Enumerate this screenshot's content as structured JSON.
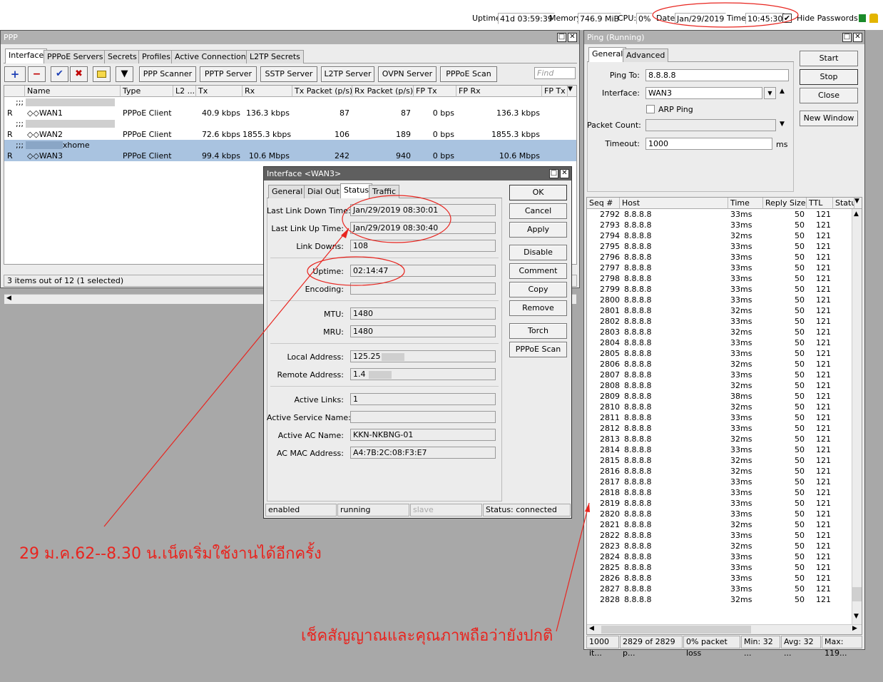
{
  "topbar": {
    "uptime_label": "Uptime:",
    "uptime": "41d 03:59:39",
    "memory_label": "Memory:",
    "memory": "746.9 MiB",
    "cpu_label": "CPU:",
    "cpu": "0%",
    "date_label": "Date:",
    "date": "Jan/29/2019",
    "time_label": "Time:",
    "time": "10:45:30",
    "hide_passwords": "Hide Passwords"
  },
  "ppp": {
    "title": "PPP",
    "tabs": [
      "Interface",
      "PPPoE Servers",
      "Secrets",
      "Profiles",
      "Active Connections",
      "L2TP Secrets"
    ],
    "toolbar": [
      "PPP Scanner",
      "PPTP Server",
      "SSTP Server",
      "L2TP Server",
      "OVPN Server",
      "PPPoE Scan"
    ],
    "find_placeholder": "Find",
    "columns": [
      "Name",
      "Type",
      "L2 ...",
      "Tx",
      "Rx",
      "Tx Packet (p/s)",
      "Rx Packet (p/s)",
      "FP Tx",
      "FP Rx",
      "FP Tx"
    ],
    "rows": [
      {
        "comment": ";;;",
        "flag": "R",
        "name": "WAN1",
        "type": "PPPoE Client",
        "tx": "40.9 kbps",
        "rx": "136.3 kbps",
        "txp": "87",
        "rxp": "87",
        "fptx": "0 bps",
        "fprx": "136.3 kbps"
      },
      {
        "comment": ";;;",
        "flag": "R",
        "name": "WAN2",
        "type": "PPPoE Client",
        "tx": "72.6 kbps",
        "rx": "1855.3 kbps",
        "txp": "106",
        "rxp": "189",
        "fptx": "0 bps",
        "fprx": "1855.3 kbps"
      },
      {
        "comment": ";;; 5871@fttxhome",
        "flag": "R",
        "name": "WAN3",
        "type": "PPPoE Client",
        "tx": "99.4 kbps",
        "rx": "10.6 Mbps",
        "txp": "242",
        "rxp": "940",
        "fptx": "0 bps",
        "fprx": "10.6 Mbps"
      }
    ],
    "status": "3 items out of 12 (1 selected)"
  },
  "iface": {
    "title": "Interface <WAN3>",
    "tabs": [
      "General",
      "Dial Out",
      "Status",
      "Traffic"
    ],
    "buttons": [
      "OK",
      "Cancel",
      "Apply",
      "Disable",
      "Comment",
      "Copy",
      "Remove",
      "Torch",
      "PPPoE Scan"
    ],
    "fields": {
      "last_link_down_label": "Last Link Down Time:",
      "last_link_down": "Jan/29/2019 08:30:01",
      "last_link_up_label": "Last Link Up Time:",
      "last_link_up": "Jan/29/2019 08:30:40",
      "link_downs_label": "Link Downs:",
      "link_downs": "108",
      "uptime_label": "Uptime:",
      "uptime": "02:14:47",
      "encoding_label": "Encoding:",
      "encoding": "",
      "mtu_label": "MTU:",
      "mtu": "1480",
      "mru_label": "MRU:",
      "mru": "1480",
      "local_address_label": "Local Address:",
      "local_address": "125.25",
      "remote_address_label": "Remote Address:",
      "remote_address": "1.4",
      "active_links_label": "Active Links:",
      "active_links": "1",
      "active_service_label": "Active Service Name:",
      "active_service": "",
      "active_ac_label": "Active AC Name:",
      "active_ac": "KKN-NKBNG-01",
      "ac_mac_label": "AC MAC Address:",
      "ac_mac": "A4:7B:2C:08:F3:E7"
    },
    "status": {
      "enabled": "enabled",
      "running": "running",
      "slave": "slave",
      "connected": "Status: connected"
    }
  },
  "ping": {
    "title": "Ping (Running)",
    "tabs": [
      "General",
      "Advanced"
    ],
    "buttons": [
      "Start",
      "Stop",
      "Close",
      "New Window"
    ],
    "ping_to_label": "Ping To:",
    "ping_to": "8.8.8.8",
    "interface_label": "Interface:",
    "interface": "WAN3",
    "arp_ping": "ARP Ping",
    "packet_count_label": "Packet Count:",
    "packet_count": "",
    "timeout_label": "Timeout:",
    "timeout": "1000",
    "timeout_unit": "ms",
    "columns": [
      "Seq #",
      "Host",
      "Time",
      "Reply Size",
      "TTL",
      "Statu"
    ],
    "seq_start": 2792,
    "host": "8.8.8.8",
    "times": [
      "33ms",
      "33ms",
      "32ms",
      "33ms",
      "33ms",
      "33ms",
      "33ms",
      "33ms",
      "33ms",
      "32ms",
      "33ms",
      "32ms",
      "33ms",
      "33ms",
      "32ms",
      "33ms",
      "32ms",
      "38ms",
      "32ms",
      "33ms",
      "33ms",
      "32ms",
      "33ms",
      "32ms",
      "32ms",
      "33ms",
      "33ms",
      "33ms",
      "33ms",
      "32ms",
      "33ms",
      "32ms",
      "33ms",
      "33ms",
      "33ms",
      "33ms",
      "32ms"
    ],
    "reply_size": "50",
    "ttl": "121",
    "status": [
      "1000 it...",
      "2829 of 2829 p...",
      "0% packet loss",
      "Min: 32 ...",
      "Avg: 32 ...",
      "Max: 119..."
    ]
  },
  "annotations": {
    "left": "29  ม.ค.62--8.30  น.เน็ตเริ่มใช้งานได้อีกครั้ง",
    "right": "เช็คสัญญาณและคุณภาพถือว่ายังปกติ"
  }
}
